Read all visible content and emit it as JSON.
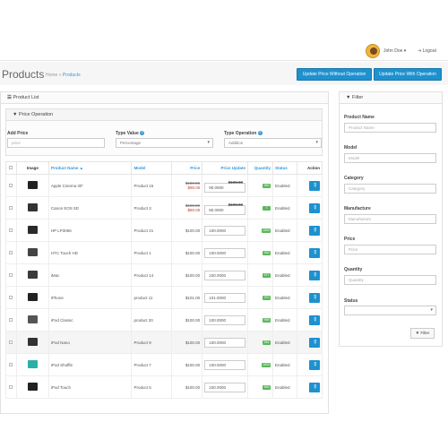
{
  "header": {
    "user_name": "John Doe",
    "user_caret": "▾",
    "logout": "Logout",
    "logout_icon": "sign-out-icon"
  },
  "page": {
    "title": "Products",
    "breadcrumb_home": "Home",
    "breadcrumb_sep": "»",
    "breadcrumb_current": "Products",
    "btn_without": "Update Price Without Operation",
    "btn_with": "Update Price With Operation"
  },
  "product_list": {
    "title": "Product List",
    "icon": "list-icon"
  },
  "price_operation": {
    "title": "Price Operation",
    "icon": "filter-icon",
    "add_price_label": "Add Price",
    "add_price_placeholder": "price",
    "type_value_label": "Type Value",
    "type_value_selected": "Percentage",
    "type_operation_label": "Type Operation",
    "type_operation_selected": "Addition",
    "help": "?"
  },
  "table": {
    "headers": {
      "image": "Image",
      "name": "Product Name",
      "name_sort": "▲",
      "model": "Model",
      "price": "Price",
      "price_update": "Price Update",
      "quantity": "Quantity",
      "status": "Status",
      "action": "Action"
    },
    "rows": [
      {
        "name": "Apple Cinema 30\"",
        "model": "Product 15",
        "price_old": "$100.00",
        "price_new": "$90.00",
        "update": "90.0000",
        "update_old": "$100.00",
        "qty": "990",
        "status": "Enabled"
      },
      {
        "name": "Canon EOS 5D",
        "model": "Product 3",
        "price_old": "$100.00",
        "price_new": "$80.00",
        "update": "80.0000",
        "update_old": "$100.00",
        "qty": "7",
        "status": "Enabled"
      },
      {
        "name": "HP LP3065",
        "model": "Product 21",
        "price": "$100.00",
        "update": "100.0000",
        "qty": "1000",
        "status": "Enabled"
      },
      {
        "name": "HTC Touch HD",
        "model": "Product 1",
        "price": "$100.00",
        "update": "100.0000",
        "qty": "939",
        "status": "Enabled"
      },
      {
        "name": "iMac",
        "model": "Product 14",
        "price": "$100.00",
        "update": "100.0000",
        "qty": "977",
        "status": "Enabled"
      },
      {
        "name": "iPhone",
        "model": "product 11",
        "price": "$101.00",
        "update": "101.0000",
        "qty": "970",
        "status": "Enabled"
      },
      {
        "name": "iPod Classic",
        "model": "product 20",
        "price": "$100.00",
        "update": "100.0000",
        "qty": "995",
        "status": "Enabled"
      },
      {
        "name": "iPod Nano",
        "model": "Product 9",
        "price": "$100.00",
        "update": "100.0000",
        "qty": "994",
        "status": "Enabled"
      },
      {
        "name": "iPod Shuffle",
        "model": "Product 7",
        "price": "$100.00",
        "update": "100.0000",
        "qty": "1000",
        "status": "Enabled"
      },
      {
        "name": "iPod Touch",
        "model": "Product 5",
        "price": "$100.00",
        "update": "100.0000",
        "qty": "999",
        "status": "Enabled"
      }
    ]
  },
  "filter": {
    "title": "Filter",
    "icon": "filter-icon",
    "fields": [
      {
        "label": "Product Name",
        "placeholder": "Product Name"
      },
      {
        "label": "Model",
        "placeholder": "Model"
      },
      {
        "label": "Category",
        "placeholder": "Category"
      },
      {
        "label": "Manufacture",
        "placeholder": "Manufacture"
      },
      {
        "label": "Price",
        "placeholder": "Price"
      },
      {
        "label": "Quantity",
        "placeholder": "Quantity"
      }
    ],
    "status_label": "Status",
    "button": "Filter"
  },
  "colors": {
    "primary": "#1e91cf",
    "success": "#5cb85c",
    "link": "#3498db",
    "danger": "#c0392b"
  }
}
